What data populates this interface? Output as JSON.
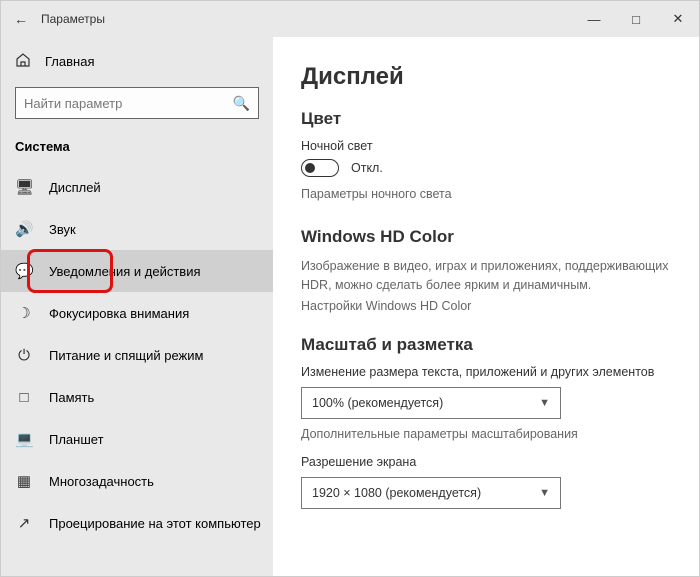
{
  "titlebar": {
    "title": "Параметры"
  },
  "sidebar": {
    "home": "Главная",
    "search_placeholder": "Найти параметр",
    "category": "Система",
    "items": [
      {
        "label": "Дисплей"
      },
      {
        "label": "Звук"
      },
      {
        "label": "Уведомления и действия"
      },
      {
        "label": "Фокусировка внимания"
      },
      {
        "label": "Питание и спящий режим"
      },
      {
        "label": "Память"
      },
      {
        "label": "Планшет"
      },
      {
        "label": "Многозадачность"
      },
      {
        "label": "Проецирование на этот компьютер"
      }
    ]
  },
  "main": {
    "title": "Дисплей",
    "color_heading": "Цвет",
    "night_light_label": "Ночной свет",
    "night_light_state": "Откл.",
    "night_light_link": "Параметры ночного света",
    "hdr_heading": "Windows HD Color",
    "hdr_desc": "Изображение в видео, играх и приложениях, поддерживающих HDR, можно сделать более ярким и динамичным.",
    "hdr_link": "Настройки Windows HD Color",
    "scale_heading": "Масштаб и разметка",
    "scale_label": "Изменение размера текста, приложений и других элементов",
    "scale_value": "100% (рекомендуется)",
    "scale_advanced": "Дополнительные параметры масштабирования",
    "resolution_label": "Разрешение экрана",
    "resolution_value": "1920 × 1080 (рекомендуется)"
  }
}
